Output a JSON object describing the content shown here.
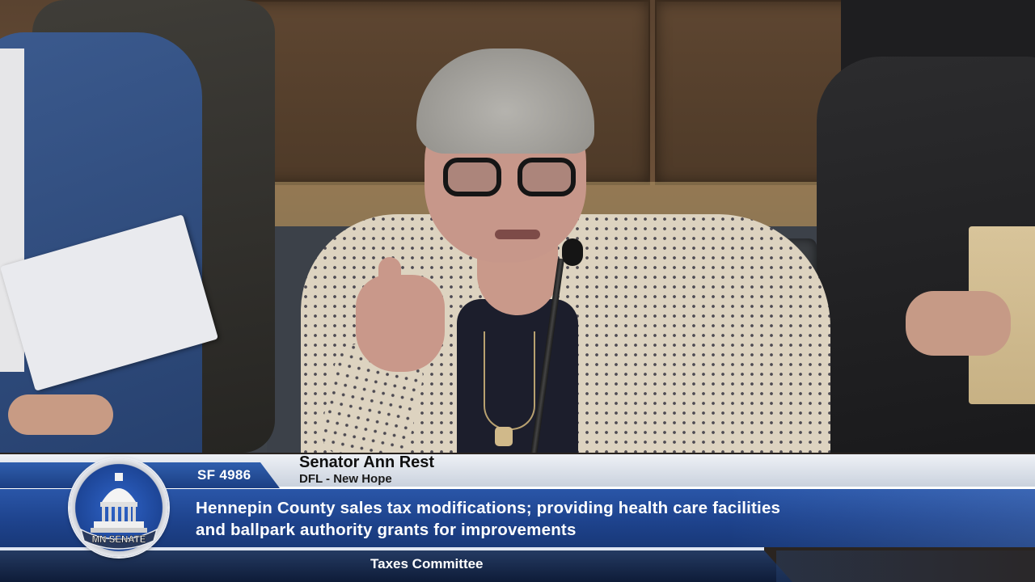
{
  "lower_third": {
    "bill_number": "SF 4986",
    "speaker_name": "Senator Ann Rest",
    "speaker_party": "DFL - New Hope",
    "bill_title_line1": "Hennepin County sales tax modifications; providing health care facilities",
    "bill_title_line2": "and ballpark authority grants for improvements",
    "committee": "Taxes Committee"
  },
  "logo": {
    "text": "MN SENATE",
    "icon": "capitol-dome-icon"
  },
  "colors": {
    "banner_blue": "#1e438d",
    "banner_light": "#eef1f6",
    "bill_tag_blue": "#2f5fae",
    "bottom_bar": "#0e1c38"
  }
}
